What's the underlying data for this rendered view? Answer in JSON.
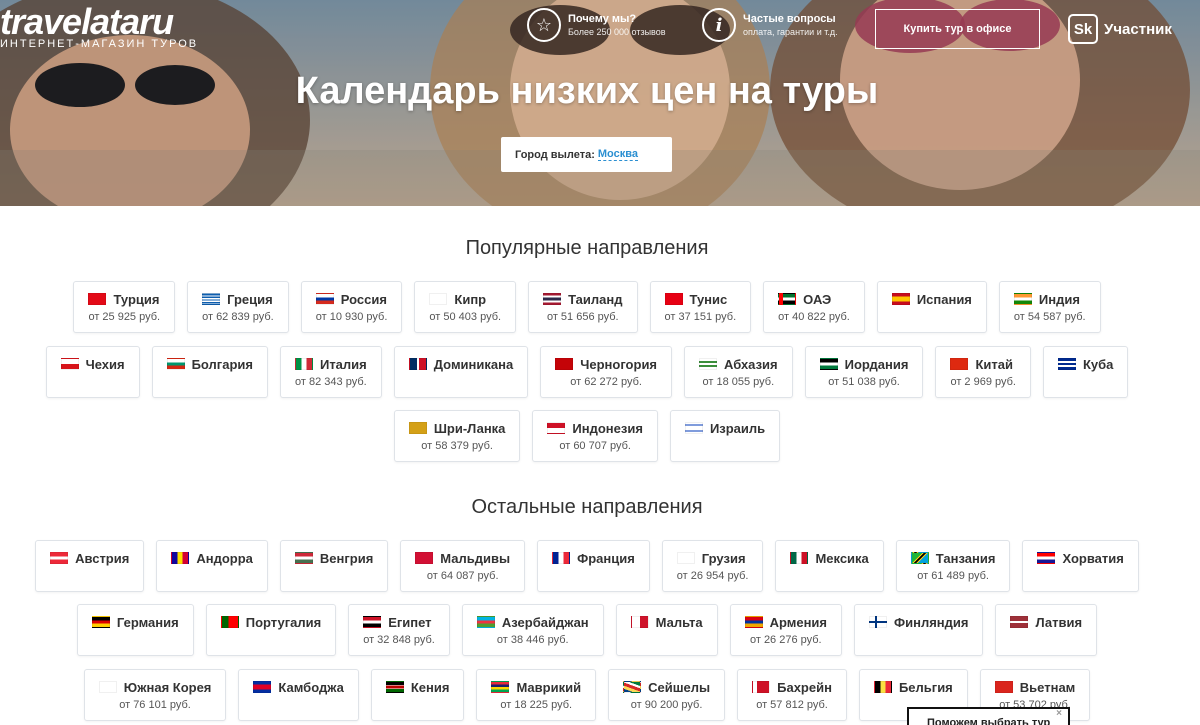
{
  "header": {
    "logo_name_main": "travelata",
    "logo_name_suffix": "ru",
    "logo_tagline": "ИНТЕРНЕТ-МАГАЗИН ТУРОВ",
    "why_title": "Почему мы?",
    "why_sub": "Более 250 000 отзывов",
    "faq_title": "Частые вопросы",
    "faq_sub": "оплата, гарантии и т.д.",
    "office_button": "Купить тур в офисе",
    "sk_logo": "Sk",
    "sk_label": "Участник"
  },
  "hero": {
    "title": "Календарь низких цен на туры",
    "city_label": "Город вылета:",
    "city_value": "Москва"
  },
  "popular_title": "Популярные направления",
  "other_title": "Остальные направления",
  "popular_rows": [
    [
      {
        "name": "Турция",
        "price": "от 25 925 руб.",
        "flag": "tr"
      },
      {
        "name": "Греция",
        "price": "от 62 839 руб.",
        "flag": "gr"
      },
      {
        "name": "Россия",
        "price": "от 10 930 руб.",
        "flag": "ru"
      },
      {
        "name": "Кипр",
        "price": "от 50 403 руб.",
        "flag": "cy"
      },
      {
        "name": "Таиланд",
        "price": "от 51 656 руб.",
        "flag": "th"
      },
      {
        "name": "Тунис",
        "price": "от 37 151 руб.",
        "flag": "tn"
      },
      {
        "name": "ОАЭ",
        "price": "от 40 822 руб.",
        "flag": "ae"
      },
      {
        "name": "Испания",
        "price": "",
        "flag": "es"
      },
      {
        "name": "Индия",
        "price": "от 54 587 руб.",
        "flag": "in"
      }
    ],
    [
      {
        "name": "Чехия",
        "price": "",
        "flag": "cz"
      },
      {
        "name": "Болгария",
        "price": "",
        "flag": "bg"
      },
      {
        "name": "Италия",
        "price": "от 82 343 руб.",
        "flag": "it"
      },
      {
        "name": "Доминикана",
        "price": "",
        "flag": "do"
      },
      {
        "name": "Черногория",
        "price": "от 62 272 руб.",
        "flag": "me"
      },
      {
        "name": "Абхазия",
        "price": "от 18 055 руб.",
        "flag": "ab"
      },
      {
        "name": "Иордания",
        "price": "от 51 038 руб.",
        "flag": "jo"
      },
      {
        "name": "Китай",
        "price": "от 2 969 руб.",
        "flag": "cn"
      },
      {
        "name": "Куба",
        "price": "",
        "flag": "cu"
      }
    ],
    [
      {
        "name": "Шри-Ланка",
        "price": "от 58 379 руб.",
        "flag": "lk"
      },
      {
        "name": "Индонезия",
        "price": "от 60 707 руб.",
        "flag": "id"
      },
      {
        "name": "Израиль",
        "price": "",
        "flag": "il"
      }
    ]
  ],
  "other_rows": [
    [
      {
        "name": "Австрия",
        "price": "",
        "flag": "at"
      },
      {
        "name": "Андорра",
        "price": "",
        "flag": "ad"
      },
      {
        "name": "Венгрия",
        "price": "",
        "flag": "hu"
      },
      {
        "name": "Мальдивы",
        "price": "от 64 087 руб.",
        "flag": "mv"
      },
      {
        "name": "Франция",
        "price": "",
        "flag": "fr"
      },
      {
        "name": "Грузия",
        "price": "от 26 954 руб.",
        "flag": "ge"
      },
      {
        "name": "Мексика",
        "price": "",
        "flag": "mx"
      },
      {
        "name": "Танзания",
        "price": "от 61 489 руб.",
        "flag": "tz"
      },
      {
        "name": "Хорватия",
        "price": "",
        "flag": "hr"
      }
    ],
    [
      {
        "name": "Германия",
        "price": "",
        "flag": "de"
      },
      {
        "name": "Португалия",
        "price": "",
        "flag": "pt"
      },
      {
        "name": "Египет",
        "price": "от 32 848 руб.",
        "flag": "eg"
      },
      {
        "name": "Азербайджан",
        "price": "от 38 446 руб.",
        "flag": "az"
      },
      {
        "name": "Мальта",
        "price": "",
        "flag": "mt"
      },
      {
        "name": "Армения",
        "price": "от 26 276 руб.",
        "flag": "am"
      },
      {
        "name": "Финляндия",
        "price": "",
        "flag": "fi"
      },
      {
        "name": "Латвия",
        "price": "",
        "flag": "lv"
      }
    ],
    [
      {
        "name": "Южная Корея",
        "price": "от 76 101 руб.",
        "flag": "kr"
      },
      {
        "name": "Камбоджа",
        "price": "",
        "flag": "kh"
      },
      {
        "name": "Кения",
        "price": "",
        "flag": "ke"
      },
      {
        "name": "Маврикий",
        "price": "от 18 225 руб.",
        "flag": "mu"
      },
      {
        "name": "Сейшелы",
        "price": "от 90 200 руб.",
        "flag": "sc"
      },
      {
        "name": "Бахрейн",
        "price": "от 57 812 руб.",
        "flag": "bh"
      },
      {
        "name": "Бельгия",
        "price": "",
        "flag": "be"
      },
      {
        "name": "Вьетнам",
        "price": "от 53 702 руб.",
        "flag": "vn"
      }
    ]
  ],
  "help": {
    "label": "Поможем выбрать тур",
    "close": "×"
  }
}
